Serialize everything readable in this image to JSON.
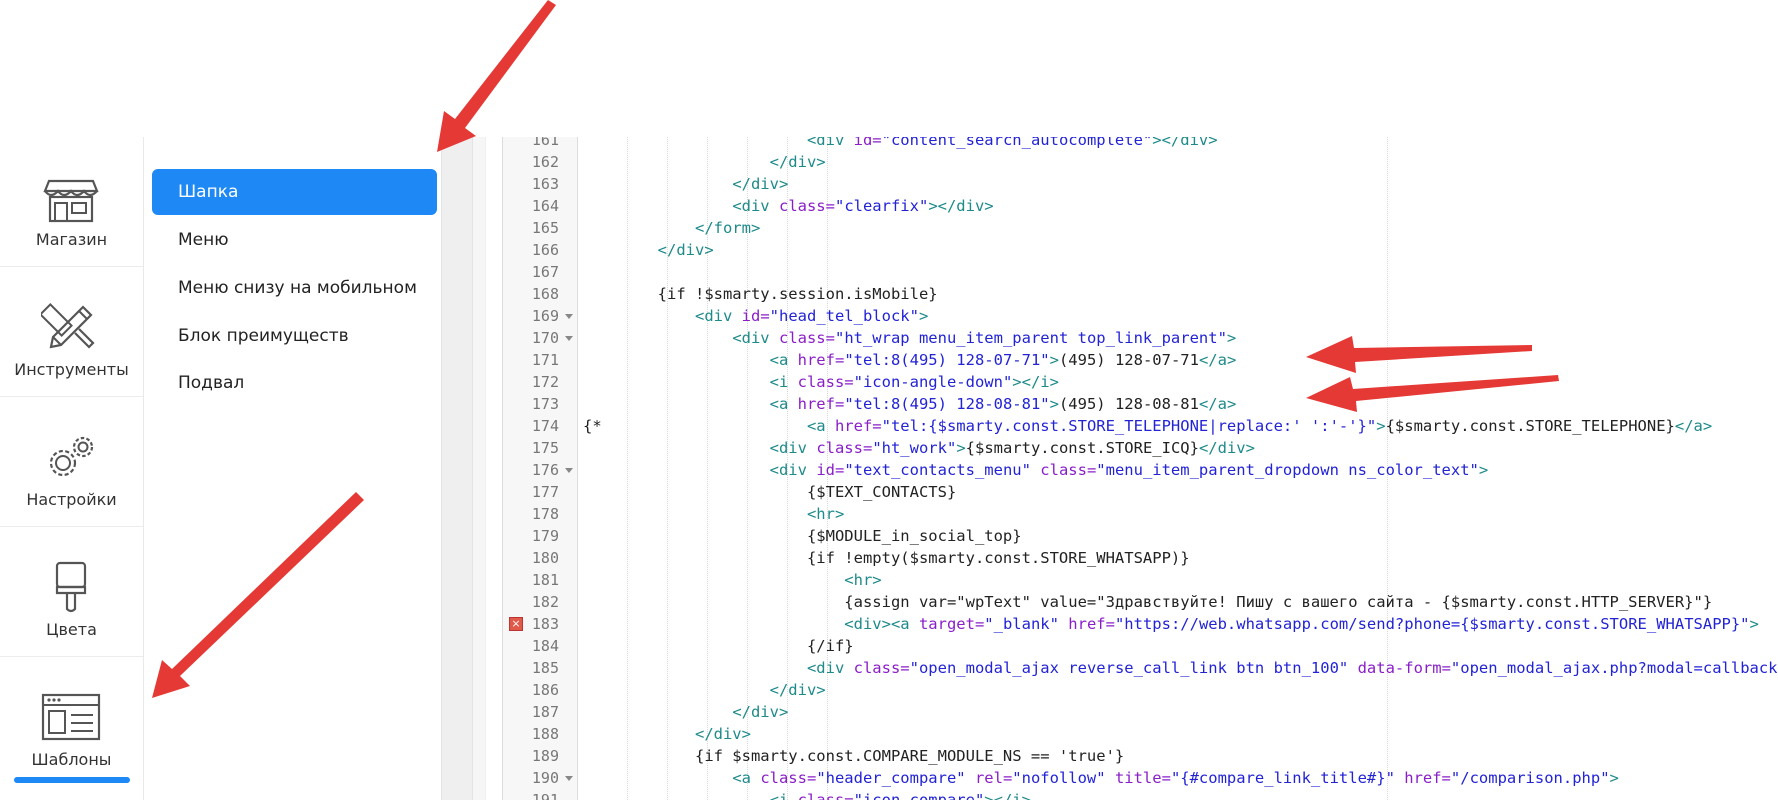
{
  "rail": {
    "items": [
      {
        "label": "Магазин",
        "icon": "store-icon"
      },
      {
        "label": "Инструменты",
        "icon": "tools-icon"
      },
      {
        "label": "Настройки",
        "icon": "gears-icon"
      },
      {
        "label": "Цвета",
        "icon": "paint-brush-icon"
      },
      {
        "label": "Шаблоны",
        "icon": "template-icon"
      }
    ],
    "active_index": 4
  },
  "submenu": {
    "items": [
      "Шапка",
      "Меню",
      "Меню снизу на мобильном",
      "Блок преимуществ",
      "Подвал"
    ],
    "active_index": 0
  },
  "editor": {
    "line_numbers": [
      "161",
      "162",
      "163",
      "164",
      "165",
      "166",
      "167",
      "168",
      "169",
      "170",
      "171",
      "172",
      "173",
      "174",
      "175",
      "176",
      "177",
      "178",
      "179",
      "180",
      "181",
      "182",
      "183",
      "184",
      "185",
      "186",
      "187",
      "188",
      "189",
      "190",
      "191"
    ],
    "folded_lines": [
      "169",
      "170",
      "176",
      "190"
    ],
    "error_lines": [
      "183"
    ]
  },
  "colors": {
    "accent": "#1e88f5",
    "arrow": "#e53935",
    "tag": "#1e8a8a",
    "attribute": "#8a1ec8",
    "string": "#2323d6"
  }
}
